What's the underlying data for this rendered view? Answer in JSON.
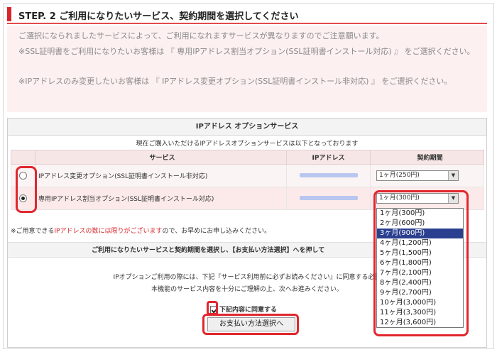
{
  "step": {
    "title": "STEP. 2 ご利用になりたいサービス、契約期間を選択してください"
  },
  "notice": {
    "line1": "ご選択になられましたサービスによって、ご利用になれますサービスが異なりますのでご注意願います。",
    "line2": "※SSL証明書をご利用になりたいお客様は 『 専用IPアドレス割当オプション(SSL証明書インストール対応) 』 をご選択ください。",
    "line3": "※IPアドレスのみ変更したいお客様は 『 IPアドレス変更オプション(SSL証明書インストール非対応) 』 をご選択ください。"
  },
  "panel": {
    "title": "IPアドレス オプションサービス",
    "current_note": "現在ご購入いただけるIPアドレスオプションサービスは以下となっております",
    "columns": {
      "service": "サービス",
      "ip": "IPアドレス",
      "term": "契約期間"
    },
    "rows": [
      {
        "service": "IPアドレス変更オプション(SSL証明書インストール非対応)",
        "term": "1ヶ月(250円)",
        "selected": false
      },
      {
        "service": "専用IPアドレス割当オプション(SSL証明書インストール対応)",
        "term": "1ヶ月(300円)",
        "selected": true
      }
    ],
    "warning": {
      "prefix": "※ご用意できる",
      "highlight": "IPアドレスの数には限りがございます",
      "suffix": "ので、お早めにお申し込みください。"
    },
    "guide": "ご利用になりたいサービスと契約期間を選択し、【お支払い方法選択】へを押して",
    "agree_line1": "IPオプションご利用の際には、下記『サービス利用前に必ずお読みください』に同意する必要",
    "agree_line2": "本機能のサービス内容を十分にご理解の上、次へお進みください。",
    "agree_label": "下記内容に同意する",
    "agree_checked": true,
    "pay_button": "お支払い方法選択へ"
  },
  "dropdown": {
    "selected_index": 2,
    "options": [
      "1ヶ月(300円)",
      "2ヶ月(600円)",
      "3ヶ月(900円)",
      "4ヶ月(1,200円)",
      "5ヶ月(1,500円)",
      "6ヶ月(1,800円)",
      "7ヶ月(2,100円)",
      "8ヶ月(2,400円)",
      "9ヶ月(2,700円)",
      "10ヶ月(3,000円)",
      "11ヶ月(3,300円)",
      "12ヶ月(3,600円)"
    ]
  },
  "icons": {
    "radio": "radio-button-icon",
    "arrow": "dropdown-arrow-icon",
    "check": "checkbox-icon"
  },
  "colors": {
    "accent": "#d7262b",
    "highlight": "#e0272e",
    "selected_option": "#2a3f8f"
  }
}
